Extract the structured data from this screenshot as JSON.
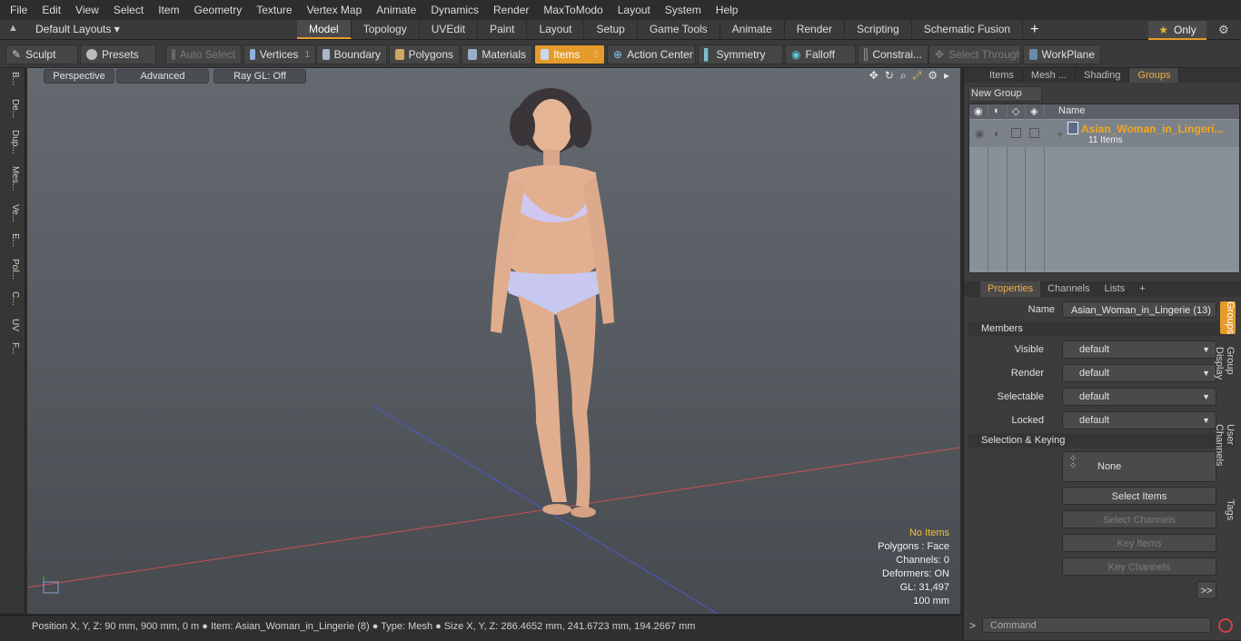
{
  "menu": [
    "File",
    "Edit",
    "View",
    "Select",
    "Item",
    "Geometry",
    "Texture",
    "Vertex Map",
    "Animate",
    "Dynamics",
    "Render",
    "MaxToModo",
    "Layout",
    "System",
    "Help"
  ],
  "layout_select": "Default Layouts",
  "mode_tabs": [
    "Model",
    "Topology",
    "UVEdit",
    "Paint",
    "Layout",
    "Setup",
    "Game Tools",
    "Animate",
    "Render",
    "Scripting",
    "Schematic Fusion"
  ],
  "only_label": "Only",
  "toolbar": {
    "sculpt": "Sculpt",
    "presets": "Presets",
    "auto_select": "Auto Select",
    "vertices": "Vertices",
    "vertices_count": "1",
    "boundary": "Boundary",
    "polygons": "Polygons",
    "materials": "Materials",
    "items": "Items",
    "items_count": "5",
    "action_center": "Action Center",
    "symmetry": "Symmetry",
    "falloff": "Falloff",
    "constraints": "Constrai...",
    "select_through": "Select Through",
    "workplane": "WorkPlane"
  },
  "left_tabs": [
    "B...",
    "De...",
    "Dup...",
    "Mes...",
    "Ve...",
    "E...",
    "Pol...",
    "C...",
    "UV",
    "F..."
  ],
  "viewport": {
    "perspective": "Perspective",
    "advanced": "Advanced",
    "raygl": "Ray GL: Off",
    "info": {
      "no_items": "No Items",
      "polygons": "Polygons : Face",
      "channels": "Channels: 0",
      "deformers": "Deformers: ON",
      "gl": "GL: 31,497",
      "scale": "100 mm"
    }
  },
  "status": "Position X, Y, Z:  90 mm, 900 mm, 0 m ● Item:  Asian_Woman_in_Lingerie (8) ● Type:  Mesh ● Size X, Y, Z:   286.4652 mm, 241.6723 mm, 194.2667 mm",
  "panel_tabs": [
    "Items",
    "Mesh ...",
    "Shading",
    "Groups"
  ],
  "new_group": "New Group",
  "group_table": {
    "name_header": "Name",
    "group_name": "Asian_Woman_in_Lingeri...",
    "group_count": "11 Items"
  },
  "props_tabs": [
    "Properties",
    "Channels",
    "Lists"
  ],
  "props": {
    "name_label": "Name",
    "name_value": "Asian_Woman_in_Lingerie (13)",
    "members_header": "Members",
    "visible_label": "Visible",
    "visible_value": "default",
    "render_label": "Render",
    "render_value": "default",
    "selectable_label": "Selectable",
    "selectable_value": "default",
    "locked_label": "Locked",
    "locked_value": "default",
    "selection_header": "Selection & Keying",
    "none_label": "None",
    "select_items": "Select Items",
    "select_channels": "Select Channels",
    "key_items": "Key Items",
    "key_channels": "Key Channels",
    "more": ">>"
  },
  "right_vtabs": [
    "Groups",
    "Group Display",
    "User Channels",
    "Tags"
  ],
  "command_placeholder": "Command",
  "colors": {
    "accent": "#e59b2b",
    "group_name": "#f2a820",
    "warning": "#f0c030"
  }
}
